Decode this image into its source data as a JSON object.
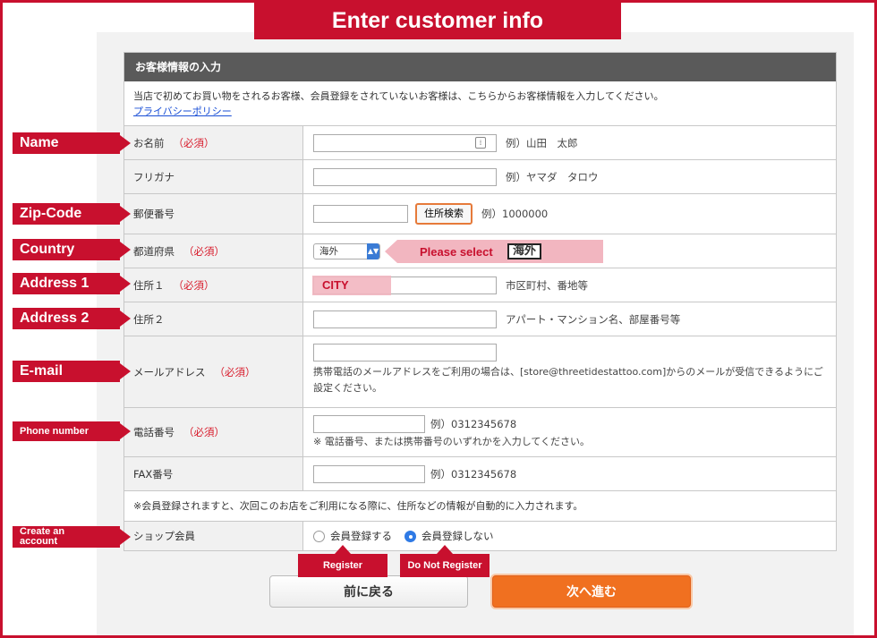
{
  "banner": {
    "title": "Enter customer info"
  },
  "form": {
    "header": "お客様情報の入力",
    "intro": "当店で初めてお買い物をされるお客様、会員登録をされていないお客様は、こちらからお客様情報を入力してください。",
    "privacy_link": "プライバシーポリシー",
    "required": "（必須）",
    "rows": {
      "name": {
        "label": "お名前",
        "example": "例）山田　太郎"
      },
      "furigana": {
        "label": "フリガナ",
        "example": "例）ヤマダ　タロウ"
      },
      "zip": {
        "label": "郵便番号",
        "button": "住所検索",
        "example": "例）1000000"
      },
      "prefecture": {
        "label": "都道府県",
        "selected": "海外"
      },
      "address1": {
        "label": "住所１",
        "example": "市区町村、番地等"
      },
      "address2": {
        "label": "住所２",
        "example": "アパート・マンション名、部屋番号等"
      },
      "email": {
        "label": "メールアドレス",
        "note": "携帯電話のメールアドレスをご利用の場合は、[store@threetidestattoo.com]からのメールが受信できるようにご設定ください。"
      },
      "phone": {
        "label": "電話番号",
        "example": "例）0312345678",
        "note": "※ 電話番号、または携帯番号のいずれかを入力してください。"
      },
      "fax": {
        "label": "FAX番号",
        "example": "例）0312345678"
      },
      "member_note": "※会員登録されますと、次回このお店をご利用になる際に、住所などの情報が自動的に入力されます。",
      "shop_member": {
        "label": "ショップ会員",
        "option_register": "会員登録する",
        "option_no_register": "会員登録しない",
        "selected": "会員登録しない"
      }
    },
    "buttons": {
      "back": "前に戻る",
      "next": "次へ進む"
    }
  },
  "annotations": {
    "name": "Name",
    "zip": "Zip-Code",
    "country": "Country",
    "address1": "Address 1",
    "address2": "Address 2",
    "email": "E-mail",
    "phone": "Phone number",
    "create_account_1": "Create an",
    "create_account_2": "account",
    "please_select": "Please select",
    "kaigai": "海外",
    "city": "CITY",
    "register": "Register",
    "do_not_register": "Do Not Register"
  },
  "colors": {
    "accent_red": "#c8102e",
    "orange": "#f07020",
    "header_gray": "#5a5a5a",
    "pink": "#f2b6c0"
  }
}
